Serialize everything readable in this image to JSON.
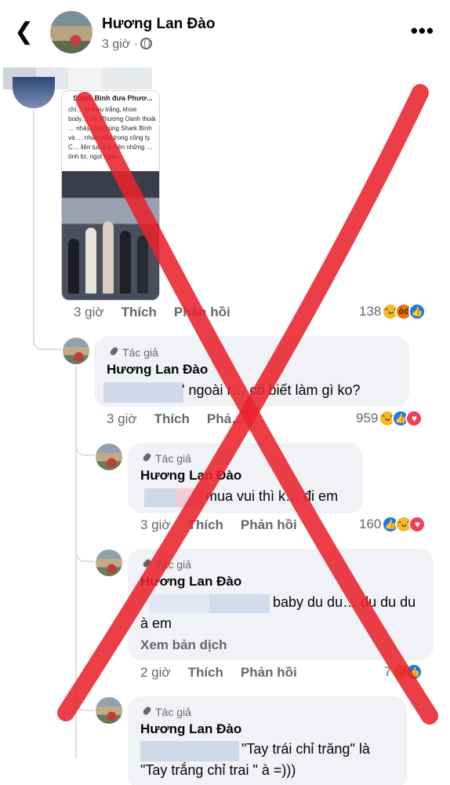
{
  "header": {
    "back_icon": "chevron-left-icon",
    "name": "Hương Lan Đào",
    "time": "3 giờ ·",
    "privacy_icon": "globe-icon",
    "more_icon": "ellipsis-icon"
  },
  "attachment": {
    "title": "Shark Bình đưa Phươ...",
    "text": "chi… m màu trắng, khoe body… nà. Phương Oanh thoải … nhảy nhót cùng Shark Bình và … nhân viên trong công ty. C… liên tục thể hiện những … tính từ, ngọt ngào."
  },
  "comment_main": {
    "time": "3 giờ",
    "like": "Thích",
    "reply": "Phản hồi",
    "react_count": "138",
    "reactions": [
      "haha",
      "angry",
      "like"
    ]
  },
  "replies": [
    {
      "tag": "Tác giả",
      "name": "Hương Lan Đào",
      "lines": [
        "' ngoài r… có biết làm gì ko?"
      ],
      "time": "3 giờ",
      "like": "Thích",
      "reply": "Phả…",
      "react_count": "959",
      "reactions": [
        "haha",
        "like",
        "love"
      ]
    },
    {
      "tag": "Tác giả",
      "name": "Hương Lan Đào",
      "lines": [
        "mua vui thì k… đi em"
      ],
      "time": "3 giờ",
      "like": "Thích",
      "reply": "Phản hồi",
      "react_count": "160",
      "reactions": [
        "like",
        "haha",
        "love"
      ]
    },
    {
      "tag": "Tác giả",
      "name": "Hương Lan Đào",
      "lines": [
        "baby du du… du du du",
        "à em"
      ],
      "see_translation": "Xem bản dịch",
      "time": "2 giờ",
      "like": "Thích",
      "reply": "Phản hồi",
      "react_count": "7",
      "reactions": [
        "haha",
        "like"
      ]
    },
    {
      "tag": "Tác giả",
      "name": "Hương Lan Đào",
      "lines": [
        "\"Tay trái chỉ trăng\" là",
        "\"Tay trắng chỉ trai \" à =)))"
      ]
    }
  ],
  "overlay": {
    "mark": "red-x",
    "color": "#e8232d"
  }
}
